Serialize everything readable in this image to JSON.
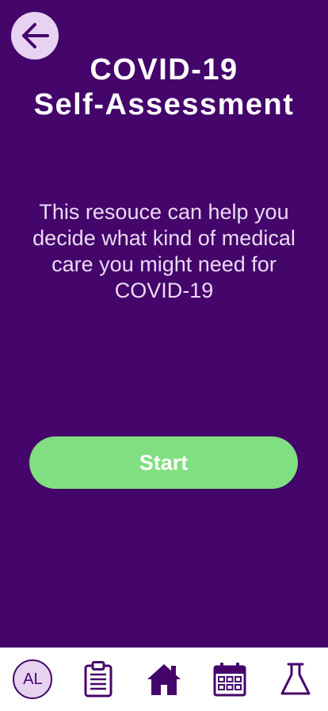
{
  "header": {
    "back_icon": "arrow-left-icon",
    "title_line1": "COVID-19",
    "title_line2": "Self-Assessment"
  },
  "main": {
    "description": "This resouce can help you decide what kind of medical care you might need for COVID-19",
    "start_label": "Start"
  },
  "nav": {
    "avatar_initials": "AL",
    "items": [
      {
        "icon": "avatar-icon"
      },
      {
        "icon": "clipboard-icon"
      },
      {
        "icon": "home-icon"
      },
      {
        "icon": "calendar-icon"
      },
      {
        "icon": "flask-icon"
      }
    ]
  },
  "colors": {
    "background": "#44066a",
    "accent_light": "#e7d2f2",
    "button_green": "#80df80",
    "nav_background": "#ffffff"
  }
}
